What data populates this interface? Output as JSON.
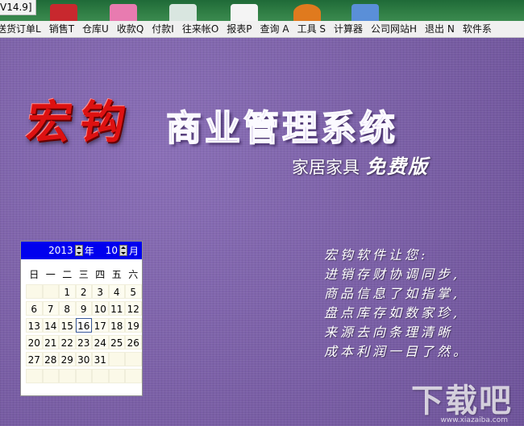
{
  "window": {
    "title_fragment": "V14.9]"
  },
  "menu": [
    "送货订单L",
    "销售T",
    "仓库U",
    "收款Q",
    "付款I",
    "往来帐O",
    "报表P",
    "查询 A",
    "工具 S",
    "计算器",
    "公司网站H",
    "退出 N",
    "软件系"
  ],
  "brand": {
    "logo": "宏钩",
    "title": "商业管理系统",
    "edition": "家居家具",
    "free_label": "免费版"
  },
  "calendar": {
    "year": "2013",
    "year_suffix": "年",
    "month": "10",
    "month_suffix": "月",
    "dow": [
      "日",
      "一",
      "二",
      "三",
      "四",
      "五",
      "六"
    ],
    "rows": [
      [
        "",
        "",
        "1",
        "2",
        "3",
        "4",
        "5"
      ],
      [
        "6",
        "7",
        "8",
        "9",
        "10",
        "11",
        "12"
      ],
      [
        "13",
        "14",
        "15",
        "16",
        "17",
        "18",
        "19"
      ],
      [
        "20",
        "21",
        "22",
        "23",
        "24",
        "25",
        "26"
      ],
      [
        "27",
        "28",
        "29",
        "30",
        "31",
        "",
        ""
      ],
      [
        "",
        "",
        "",
        "",
        "",
        "",
        ""
      ]
    ],
    "today": "16"
  },
  "poem": [
    "宏钩软件让您:",
    "进销存财协调同步,",
    "商品信息了如指掌,",
    "盘点库存如数家珍,",
    "来源去向条理清晰",
    "成本利润一目了然。"
  ],
  "watermark": {
    "text": "下载吧",
    "url": "www.xiazaiba.com"
  },
  "colors": {
    "background": "#7a5fa6",
    "calendar_header": "#0000ee",
    "logo": "#d11111"
  }
}
